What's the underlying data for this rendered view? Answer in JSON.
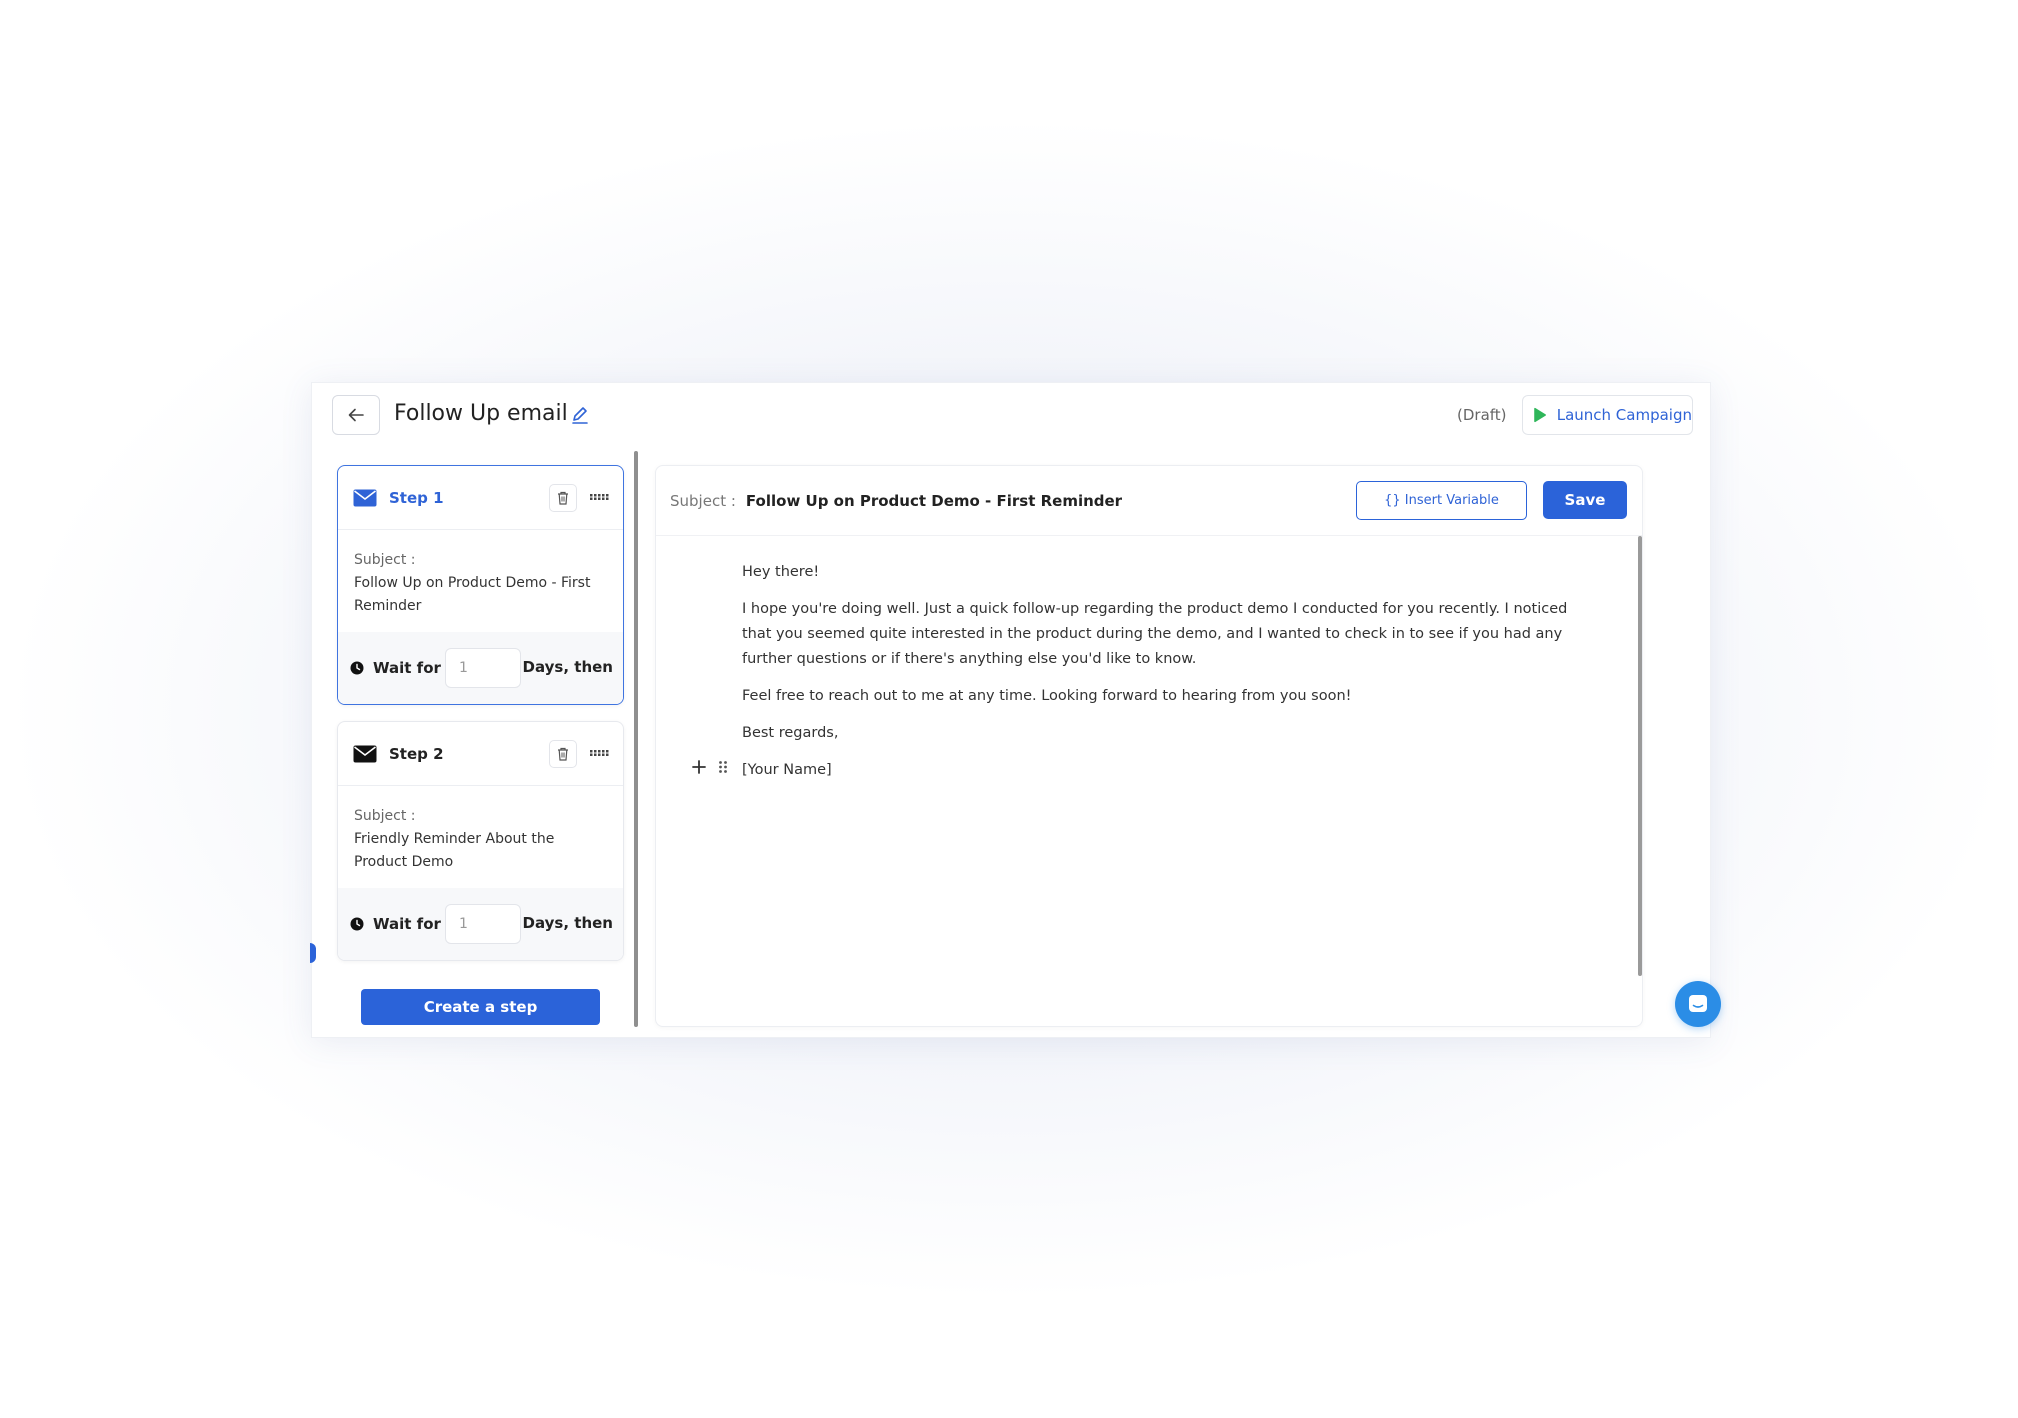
{
  "header": {
    "title": "Follow Up email",
    "status": "(Draft)",
    "launch_label": "Launch Campaign"
  },
  "steps": [
    {
      "title": "Step 1",
      "subject_label": "Subject :",
      "subject": "Follow Up on Product Demo - First Reminder",
      "wait_label": "Wait for",
      "wait_value": "1",
      "days_label": "Days, then",
      "active": true
    },
    {
      "title": "Step 2",
      "subject_label": "Subject :",
      "subject": "Friendly Reminder About the Product Demo",
      "wait_label": "Wait for",
      "wait_value": "1",
      "days_label": "Days, then",
      "active": false
    }
  ],
  "create_step_label": "Create a step",
  "editor": {
    "subject_label": "Subject :",
    "subject_value": "Follow Up on Product Demo - First Reminder",
    "insert_variable_label": "{} Insert Variable",
    "save_label": "Save",
    "body": [
      "Hey there!",
      "I hope you're doing well. Just a quick follow-up regarding the product demo I conducted for you recently. I noticed that you seemed quite interested in the product during the demo, and I wanted to check in to see if you had any further questions or if there's anything else you'd like to know.",
      "Feel free to reach out to me at any time. Looking forward to hearing from you soon!",
      "Best regards,",
      "[Your Name]"
    ]
  },
  "colors": {
    "accent": "#2b63d9",
    "launch_icon": "#2fb65a",
    "chat": "#2b8de6"
  },
  "icons": {
    "back": "arrow-left-icon",
    "edit": "pencil-icon",
    "launch": "play-icon",
    "step": "envelope-icon",
    "delete": "trash-icon",
    "drag": "grip-icon",
    "wait": "clock-icon",
    "add_block": "plus-icon",
    "drag_block": "drag-dots-icon",
    "chat": "chat-icon"
  }
}
